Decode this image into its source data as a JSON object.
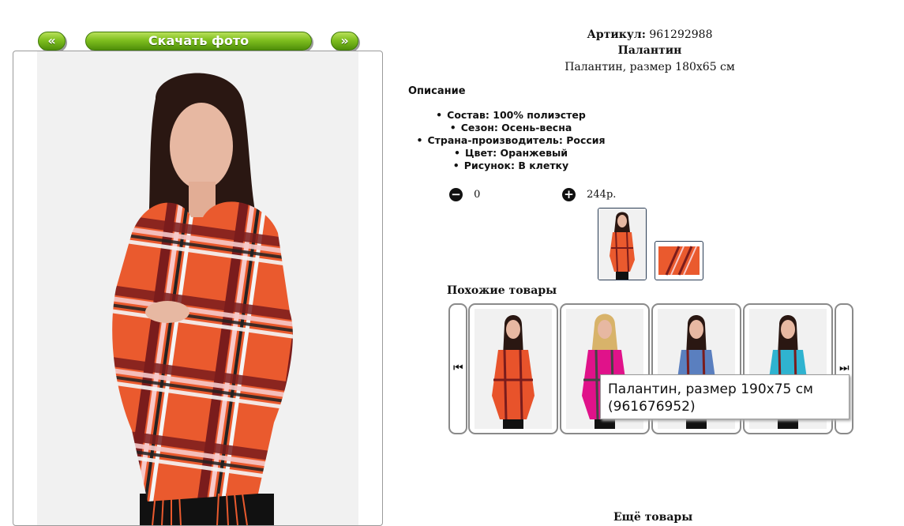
{
  "nav": {
    "prev_label": "«",
    "download_label": "Скачать фото",
    "next_label": "»"
  },
  "product": {
    "article_label": "Артикул:",
    "article_value": "961292988",
    "title": "Палантин",
    "subtitle": "Палантин, размер 180х65 см"
  },
  "description": {
    "heading": "Описание",
    "items": [
      "Состав: 100% полиэстер",
      "Сезон: Осень-весна",
      "Страна-производитель: Россия",
      "Цвет: Оранжевый",
      "Рисунок: В клетку"
    ]
  },
  "quantity": {
    "minus_icon": "minus-circle-icon",
    "value": "0",
    "plus_icon": "plus-circle-icon",
    "price": "244р."
  },
  "similar": {
    "heading": "Похожие товары",
    "tooltip_line1": "Палантин, размер 190х75 см",
    "tooltip_line2": "(961676952)",
    "colors": [
      "#e8532b",
      "#e0128a",
      "#5a7fbf",
      "#2fb3d0"
    ]
  },
  "more": {
    "heading": "Ещё товары"
  },
  "colors": {
    "button_green": "#7fbf1f",
    "scarf_orange": "#ea5a2e"
  }
}
